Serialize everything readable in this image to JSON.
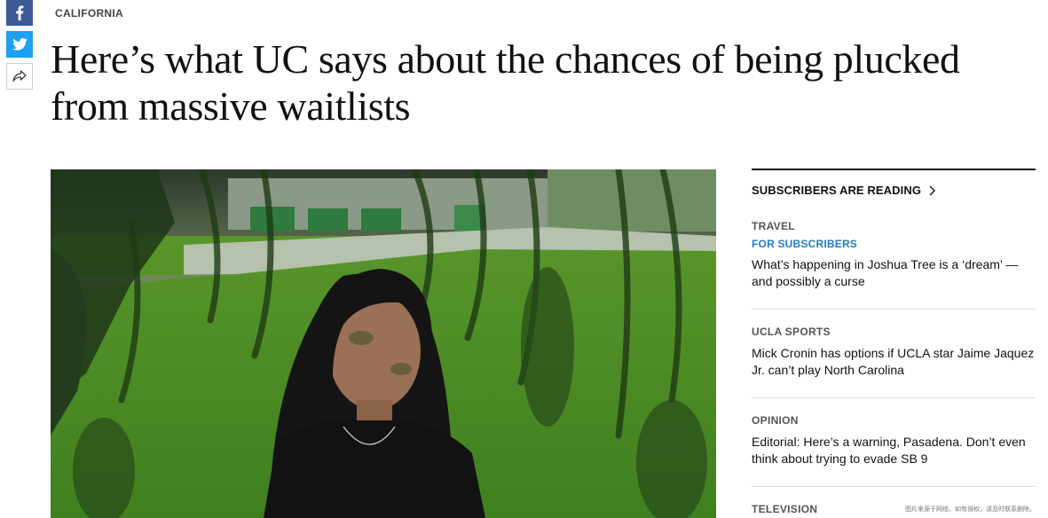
{
  "share": {
    "facebook_icon": "facebook-icon",
    "twitter_icon": "twitter-icon",
    "share_icon": "share-arrow-icon"
  },
  "article": {
    "section": "CALIFORNIA",
    "headline": "Here’s what UC says about the chances of being plucked from massive waitlists"
  },
  "sidebar": {
    "heading": "SUBSCRIBERS ARE READING",
    "items": [
      {
        "kicker": "TRAVEL",
        "badge": "FOR SUBSCRIBERS",
        "title": "What’s happening in Joshua Tree is a ‘dream’ — and possibly a curse"
      },
      {
        "kicker": "UCLA SPORTS",
        "title": "Mick Cronin has options if UCLA star Jaime Jaquez Jr. can’t play North Carolina"
      },
      {
        "kicker": "OPINION",
        "title": "Editorial: Here’s a warning, Pasadena. Don’t even think about trying to evade SB 9"
      },
      {
        "kicker": "TELEVISION"
      }
    ]
  },
  "colors": {
    "facebook": "#3b5998",
    "twitter": "#1da1f2",
    "subscriber_badge": "#1f7cc2"
  },
  "watermark": "图片来源于网络，如有侵权，请及时联系删除。"
}
